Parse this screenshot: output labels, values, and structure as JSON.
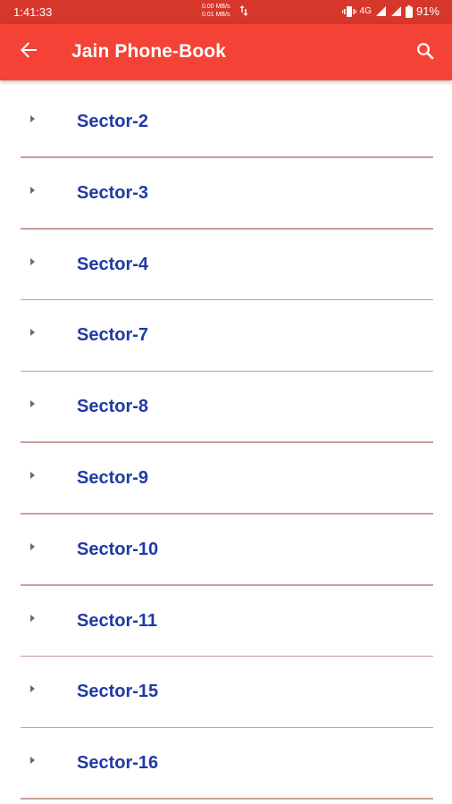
{
  "status_bar": {
    "time": "1:41:33",
    "net_down": "0.00 MB/s",
    "net_up": "0.01 MB/s",
    "network_type": "4G",
    "battery": "91%"
  },
  "app_bar": {
    "title": "Jain Phone-Book",
    "background_color": "#f44336"
  },
  "list": {
    "items": [
      {
        "label": "Sector-2"
      },
      {
        "label": "Sector-3"
      },
      {
        "label": "Sector-4"
      },
      {
        "label": "Sector-7"
      },
      {
        "label": "Sector-8"
      },
      {
        "label": "Sector-9"
      },
      {
        "label": "Sector-10"
      },
      {
        "label": "Sector-11"
      },
      {
        "label": "Sector-15"
      },
      {
        "label": "Sector-16"
      }
    ],
    "label_color": "#1f3aa8",
    "divider_color": "#c9a09a"
  }
}
